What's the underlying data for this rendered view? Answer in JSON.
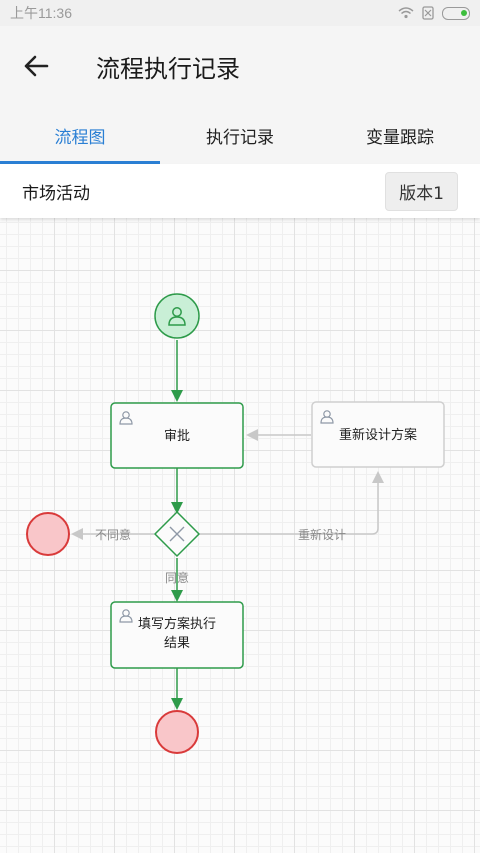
{
  "status": {
    "time": "上午11:36"
  },
  "header": {
    "title": "流程执行记录"
  },
  "tabs": [
    {
      "label": "流程图"
    },
    {
      "label": "执行记录"
    },
    {
      "label": "变量跟踪"
    }
  ],
  "process": {
    "name": "市场活动",
    "version": "版本1"
  },
  "diagram": {
    "nodes": {
      "approve": "审批",
      "redesign": "重新设计方案",
      "fill_line1": "填写方案执行",
      "fill_line2": "结果"
    },
    "edges": {
      "disagree": "不同意",
      "redesign": "重新设计",
      "agree": "同意"
    },
    "colors": {
      "green": "#2e9b4a",
      "green_fill": "#c9efd6",
      "red": "#d93a3a",
      "red_fill": "#f9c6c9",
      "gray_line": "#c8c8c8"
    }
  }
}
